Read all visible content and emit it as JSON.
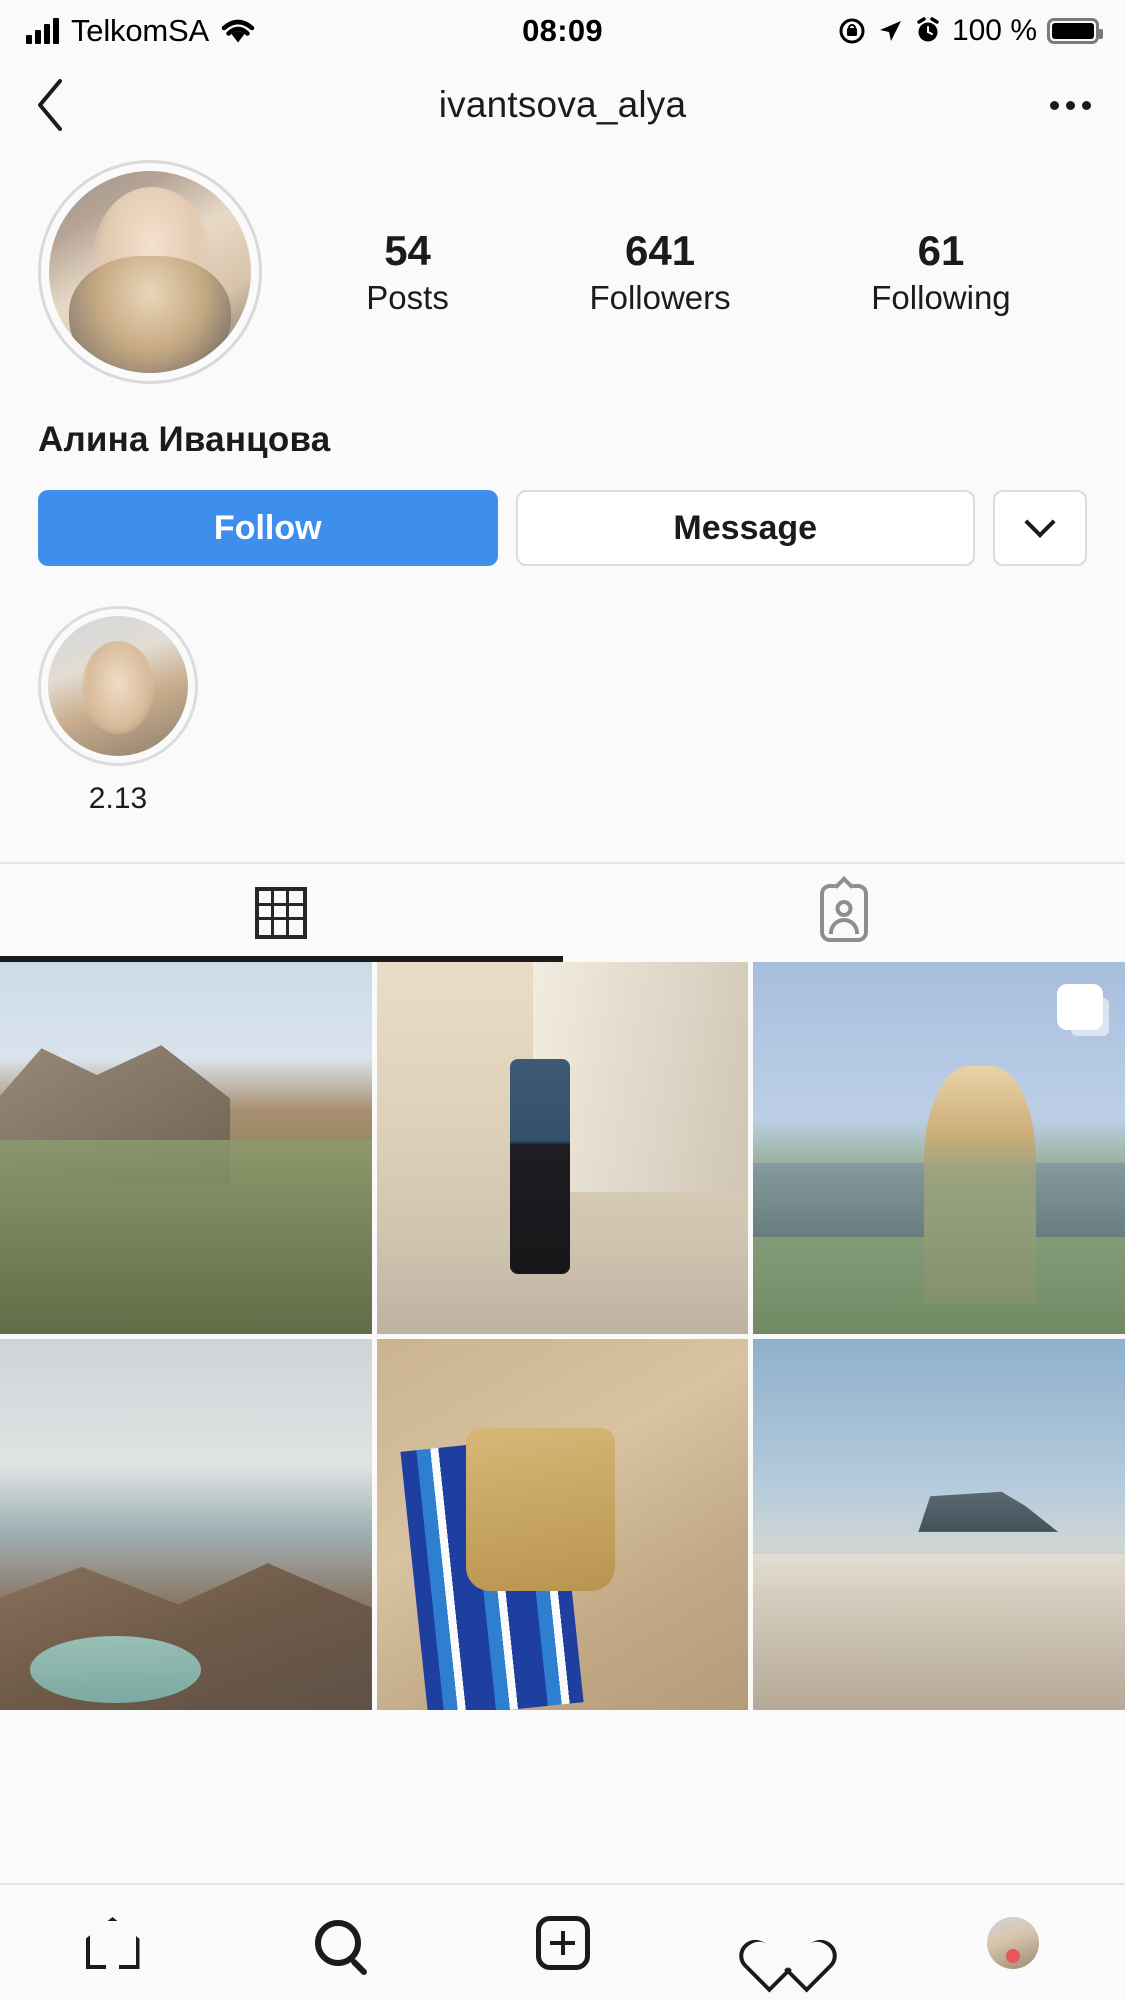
{
  "status_bar": {
    "carrier": "TelkomSA",
    "time": "08:09",
    "battery_percent": "100 %",
    "icons": [
      "signal-bars-icon",
      "wifi-icon",
      "rotation-lock-icon",
      "location-arrow-icon",
      "alarm-clock-icon",
      "battery-icon"
    ]
  },
  "navbar": {
    "back_icon": "chevron-left-icon",
    "title": "ivantsova_alya",
    "more_icon": "more-options-icon"
  },
  "profile": {
    "avatar_name": "profile-avatar",
    "full_name": "Алина Иванцова",
    "stats": [
      {
        "value": "54",
        "label": "Posts"
      },
      {
        "value": "641",
        "label": "Followers"
      },
      {
        "value": "61",
        "label": "Following"
      }
    ],
    "actions": {
      "follow": "Follow",
      "message": "Message",
      "dropdown_icon": "chevron-down-icon"
    },
    "highlights": [
      {
        "label": "2.13"
      }
    ]
  },
  "tabs": [
    {
      "name": "grid",
      "icon": "grid-icon",
      "active": true
    },
    {
      "name": "tagged",
      "icon": "tagged-person-icon",
      "active": false
    }
  ],
  "posts": [
    {
      "art": "a1",
      "alt": "mountain-ridge-overlook",
      "multi": false
    },
    {
      "art": "a2",
      "alt": "boutique-interior-mirror-selfie",
      "multi": false
    },
    {
      "art": "a3",
      "alt": "airshow-crowd-straw-hat",
      "multi": true
    },
    {
      "art": "a4",
      "alt": "waves-crashing-on-rocks",
      "multi": false
    },
    {
      "art": "a5",
      "alt": "straw-bag-on-beach-towel",
      "multi": false
    },
    {
      "art": "a6",
      "alt": "table-mountain-beach-shoreline",
      "multi": false
    }
  ],
  "bottom_nav": [
    {
      "name": "home",
      "icon": "home-icon"
    },
    {
      "name": "search",
      "icon": "search-icon"
    },
    {
      "name": "create",
      "icon": "plus-square-icon"
    },
    {
      "name": "activity",
      "icon": "heart-icon"
    },
    {
      "name": "profile",
      "icon": "profile-avatar-icon",
      "badge": true
    }
  ],
  "colors": {
    "accent_blue": "#3e8eec",
    "background": "#fafafa",
    "text": "#1b1b1b",
    "muted": "#8e8e8e",
    "badge_red": "#e8565a"
  }
}
